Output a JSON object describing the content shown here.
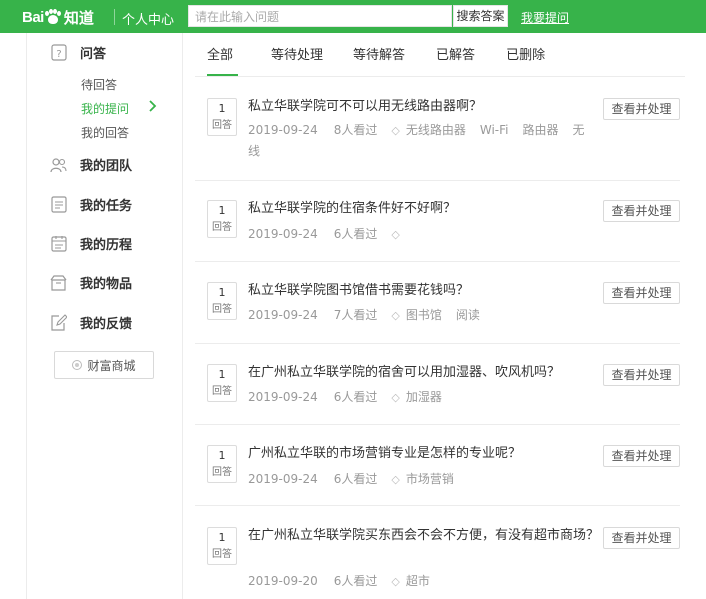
{
  "header": {
    "logo_text": "Bai",
    "logo_suffix": "知道",
    "personal_center": "个人中心",
    "search_placeholder": "请在此输入问题",
    "search_button": "搜索答案",
    "ask_link": "我要提问"
  },
  "sidebar": {
    "qa_label": "问答",
    "qa_items": [
      {
        "label": "待回答",
        "active": false
      },
      {
        "label": "我的提问",
        "active": true
      },
      {
        "label": "我的回答",
        "active": false
      }
    ],
    "sections": [
      {
        "label": "我的团队",
        "icon": "team-icon"
      },
      {
        "label": "我的任务",
        "icon": "task-icon"
      },
      {
        "label": "我的历程",
        "icon": "history-icon"
      },
      {
        "label": "我的物品",
        "icon": "items-icon"
      },
      {
        "label": "我的反馈",
        "icon": "feedback-icon"
      }
    ],
    "wealth_button": "财富商城"
  },
  "tabs": [
    {
      "label": "全部",
      "active": true
    },
    {
      "label": "等待处理",
      "active": false
    },
    {
      "label": "等待解答",
      "active": false
    },
    {
      "label": "已解答",
      "active": false
    },
    {
      "label": "已删除",
      "active": false
    }
  ],
  "questions": [
    {
      "answers": "1",
      "answer_unit": "回答",
      "title": "私立华联学院可不可以用无线路由器啊？",
      "date": "2019-09-24",
      "views": "8人看过",
      "tags": [
        "无线路由器",
        "Wi-Fi",
        "路由器",
        "无线"
      ],
      "action": "查看并处理"
    },
    {
      "answers": "1",
      "answer_unit": "回答",
      "title": "私立华联学院的住宿条件好不好啊？",
      "date": "2019-09-24",
      "views": "6人看过",
      "tags": [],
      "action": "查看并处理"
    },
    {
      "answers": "1",
      "answer_unit": "回答",
      "title": "私立华联学院图书馆借书需要花钱吗？",
      "date": "2019-09-24",
      "views": "7人看过",
      "tags": [
        "图书馆",
        "阅读"
      ],
      "action": "查看并处理"
    },
    {
      "answers": "1",
      "answer_unit": "回答",
      "title": "在广州私立华联学院的宿舍可以用加湿器、吹风机吗？",
      "date": "2019-09-24",
      "views": "6人看过",
      "tags": [
        "加湿器"
      ],
      "action": "查看并处理"
    },
    {
      "answers": "1",
      "answer_unit": "回答",
      "title": "广州私立华联的市场营销专业是怎样的专业呢？",
      "date": "2019-09-24",
      "views": "6人看过",
      "tags": [
        "市场营销"
      ],
      "action": "查看并处理"
    },
    {
      "answers": "1",
      "answer_unit": "回答",
      "title": "在广州私立华联学院买东西会不会不方便，有没有超市商场？",
      "date": "2019-09-20",
      "views": "6人看过",
      "tags": [
        "超市"
      ],
      "action": "查看并处理"
    }
  ],
  "colors": {
    "brand_green": "#37b34a"
  }
}
